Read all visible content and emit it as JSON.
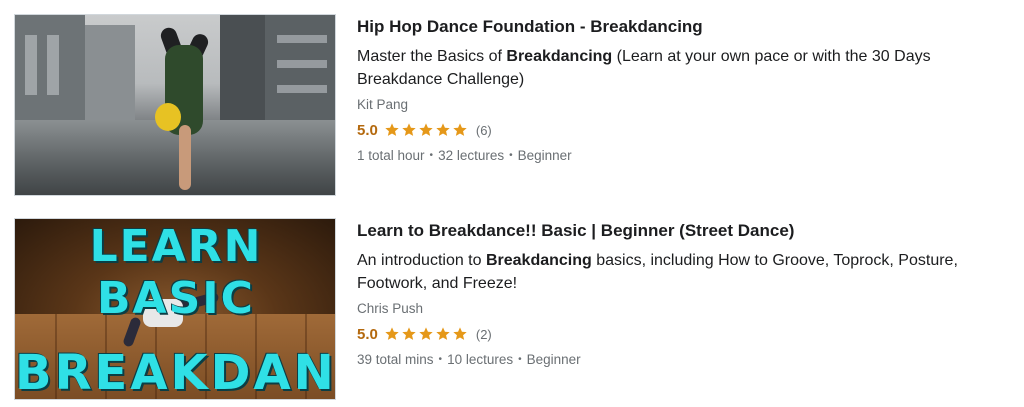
{
  "colors": {
    "rating": "#b4690e",
    "star": "#e59819",
    "muted": "#6a6f73"
  },
  "courses": [
    {
      "title": "Hip Hop Dance Foundation - Breakdancing",
      "headline_pre": "Master the Basics of ",
      "headline_bold": "Breakdancing",
      "headline_post": " (Learn at your own pace or with the 30 Days Breakdance Challenge)",
      "instructor": "Kit Pang",
      "rating": "5.0",
      "stars": 5,
      "count": "(6)",
      "duration": "1 total hour",
      "lectures": "32 lectures",
      "level": "Beginner"
    },
    {
      "title": "Learn to Breakdance!! Basic | Beginner (Street Dance)",
      "headline_pre": "An introduction to ",
      "headline_bold": "Breakdancing",
      "headline_post": " basics, including How to Groove, Toprock, Posture, Footwork, and Freeze!",
      "instructor": "Chris Push",
      "rating": "5.0",
      "stars": 5,
      "count": "(2)",
      "duration": "39 total mins",
      "lectures": "10 lectures",
      "level": "Beginner",
      "thumb_text_top": "LEARN BASIC",
      "thumb_text_bottom": "BREAKDANCE"
    }
  ],
  "separator": "•"
}
